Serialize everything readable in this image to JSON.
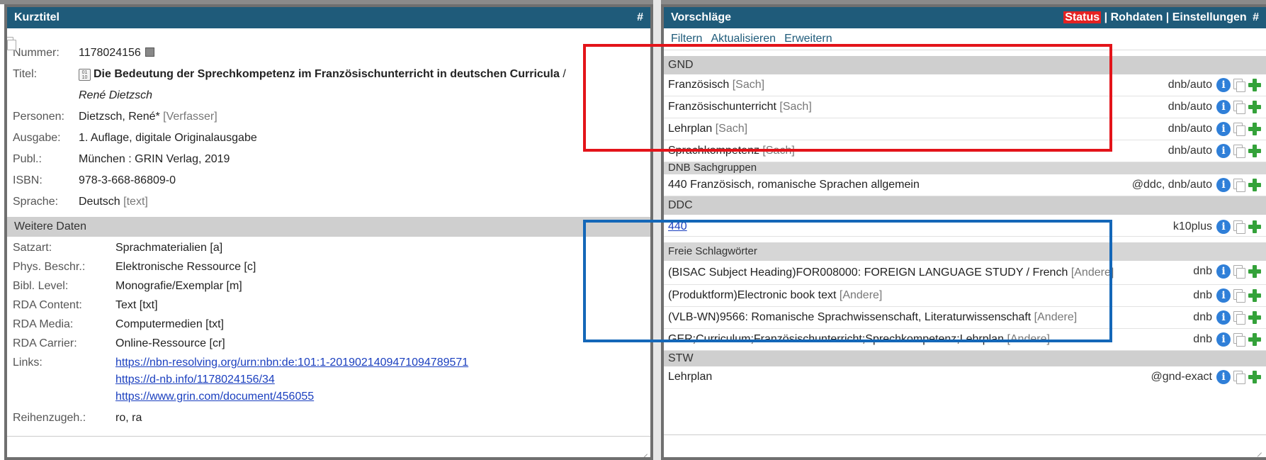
{
  "left": {
    "title": "Kurztitel",
    "hash": "#",
    "kurztitel": {
      "nummer_label": "Nummer:",
      "nummer": "1178024156",
      "titel_label": "Titel:",
      "titel": "Die Bedeutung der Sprechkompetenz im Französischunterricht in deutschen Curricula",
      "titel_sep": " /",
      "autor": "René Dietzsch",
      "personen_label": "Personen:",
      "personen": "Dietzsch, René*",
      "personen_role": "[Verfasser]",
      "ausgabe_label": "Ausgabe:",
      "ausgabe": "1. Auflage, digitale Originalausgabe",
      "publ_label": "Publ.:",
      "publ": "München : GRIN Verlag, 2019",
      "isbn_label": "ISBN:",
      "isbn": "978-3-668-86809-0",
      "sprache_label": "Sprache:",
      "sprache": "Deutsch",
      "sprache_code": "[text]"
    },
    "weitere_title": "Weitere Daten",
    "weitere": [
      {
        "label": "Satzart:",
        "value": "Sprachmaterialien [a]"
      },
      {
        "label": "Phys. Beschr.:",
        "value": "Elektronische Ressource [c]"
      },
      {
        "label": "Bibl. Level:",
        "value": "Monografie/Exemplar [m]"
      },
      {
        "label": "RDA Content:",
        "value": "Text [txt]"
      },
      {
        "label": "RDA Media:",
        "value": "Computermedien [txt]"
      },
      {
        "label": "RDA Carrier:",
        "value": "Online-Ressource [cr]"
      }
    ],
    "links_label": "Links:",
    "links": [
      "https://nbn-resolving.org/urn:nbn:de:101:1-2019021409471094789571",
      "https://d-nb.info/1178024156/34",
      "https://www.grin.com/document/456055"
    ],
    "reihe_label": "Reihenzugeh.:",
    "reihe": "ro, ra"
  },
  "right": {
    "title": "Vorschläge",
    "status": "Status",
    "rohdaten": "Rohdaten",
    "einstellungen": "Einstellungen",
    "hash": "#",
    "sep": "|",
    "menu": {
      "filtern": "Filtern",
      "aktualisieren": "Aktualisieren",
      "erweitern": "Erweitern"
    },
    "gnd_title": "GND",
    "gnd": [
      {
        "text": "Französisch",
        "type": "[Sach]",
        "src": "dnb/auto"
      },
      {
        "text": "Französischunterricht",
        "type": "[Sach]",
        "src": "dnb/auto"
      },
      {
        "text": "Lehrplan",
        "type": "[Sach]",
        "src": "dnb/auto"
      },
      {
        "text": "Sprachkompetenz",
        "type": "[Sach]",
        "src": "dnb/auto"
      }
    ],
    "dnb_title": "DNB Sachgruppen",
    "dnb": {
      "text": "440 Französisch, romanische Sprachen allgemein",
      "src": "@ddc, dnb/auto"
    },
    "ddc_title": "DDC",
    "ddc": {
      "text": "440",
      "src": "k10plus"
    },
    "frei_title": "Freie Schlagwörter",
    "frei": [
      {
        "text": "(BISAC Subject Heading)FOR008000: FOREIGN LANGUAGE STUDY / French",
        "type": "[Andere]",
        "src": "dnb"
      },
      {
        "text": "(Produktform)Electronic book text",
        "type": "[Andere]",
        "src": "dnb"
      },
      {
        "text": "(VLB-WN)9566: Romanische Sprachwissenschaft, Literaturwissenschaft",
        "type": "[Andere]",
        "src": "dnb"
      },
      {
        "text": "GER;Curriculum;Französischunterricht;Sprechkompetenz;Lehrplan",
        "type": "[Andere]",
        "src": "dnb"
      }
    ],
    "stw_title": "STW",
    "stw": {
      "text": "Lehrplan",
      "src": "@gnd-exact"
    }
  },
  "icons": {
    "info": "i",
    "book": "01 10"
  },
  "colors": {
    "header_bg": "#1f5b7a",
    "status_bg": "#e52222",
    "highlight_red": "#e3141a",
    "highlight_blue": "#1467b8",
    "add": "#34a23a",
    "info": "#2f7fd8"
  }
}
